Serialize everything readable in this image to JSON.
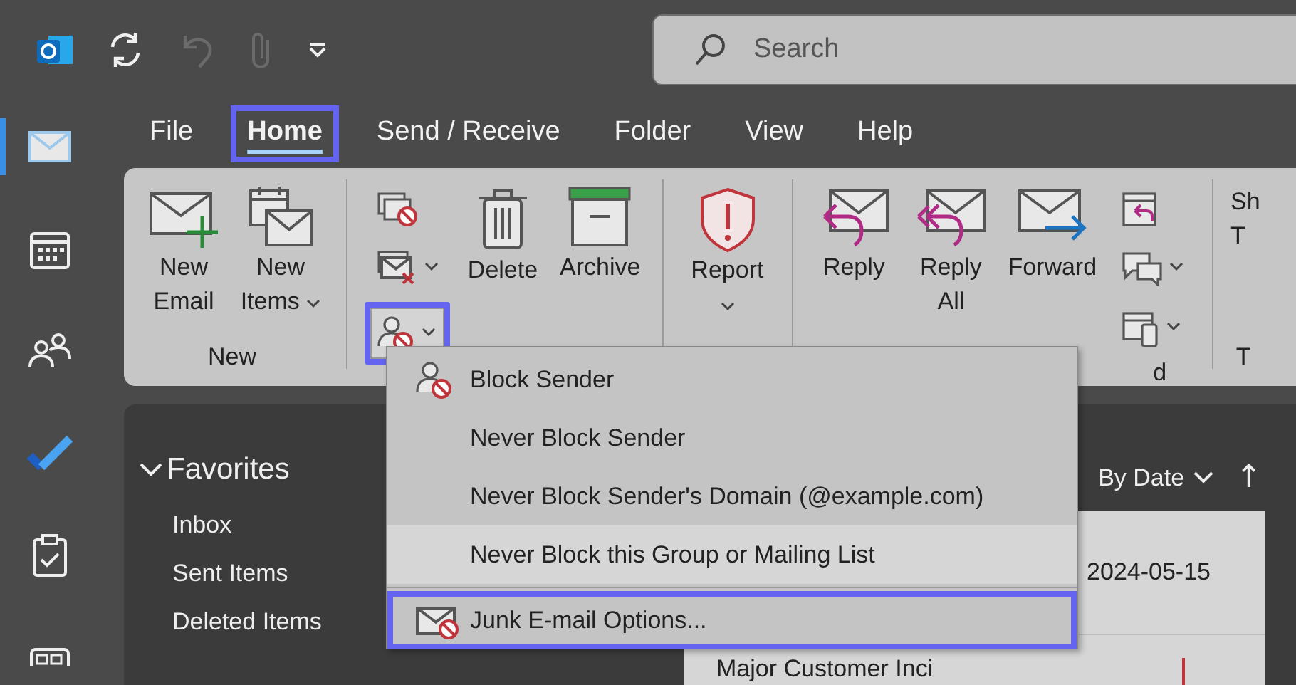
{
  "title_bar": {
    "quick_access": [
      {
        "kind": "sync",
        "disabled": false
      },
      {
        "kind": "undo",
        "disabled": true
      },
      {
        "kind": "attach",
        "disabled": true
      },
      {
        "kind": "customize",
        "disabled": false
      }
    ],
    "search": {
      "placeholder": "Search"
    }
  },
  "nav_rail": [
    {
      "kind": "mail",
      "selected": true
    },
    {
      "kind": "calendar",
      "selected": false
    },
    {
      "kind": "people",
      "selected": false
    },
    {
      "kind": "todo",
      "selected": false
    },
    {
      "kind": "tasks",
      "selected": false
    },
    {
      "kind": "apps",
      "selected": false
    }
  ],
  "menu_tabs": [
    {
      "label": "File",
      "selected": false,
      "highlighted": false
    },
    {
      "label": "Home",
      "selected": true,
      "highlighted": true
    },
    {
      "label": "Send / Receive",
      "selected": false,
      "highlighted": false
    },
    {
      "label": "Folder",
      "selected": false,
      "highlighted": false
    },
    {
      "label": "View",
      "selected": false,
      "highlighted": false
    },
    {
      "label": "Help",
      "selected": false,
      "highlighted": false
    }
  ],
  "ribbon": {
    "groups": [
      {
        "label": "New",
        "buttons": [
          {
            "kind": "new-email",
            "label": "New Email",
            "dropdown": false
          },
          {
            "kind": "new-items",
            "label": "New Items",
            "dropdown": true
          }
        ]
      },
      {
        "small_buttons": [
          {
            "kind": "ignore",
            "dropdown": false,
            "highlighted": false
          },
          {
            "kind": "clean-up",
            "dropdown": true,
            "highlighted": false
          },
          {
            "kind": "junk",
            "dropdown": true,
            "highlighted": true
          }
        ],
        "buttons": [
          {
            "kind": "delete",
            "label": "Delete",
            "dropdown": false
          },
          {
            "kind": "archive",
            "label": "Archive",
            "dropdown": false
          }
        ]
      },
      {
        "buttons": [
          {
            "kind": "report",
            "label": "Report",
            "dropdown": true
          }
        ]
      },
      {
        "label": "d",
        "buttons": [
          {
            "kind": "reply",
            "label": "Reply",
            "dropdown": false
          },
          {
            "kind": "reply-all",
            "label": "Reply All",
            "dropdown": false
          },
          {
            "kind": "forward",
            "label": "Forward",
            "dropdown": false
          }
        ],
        "small_buttons": [
          {
            "kind": "meeting-reply",
            "dropdown": false,
            "highlighted": false
          },
          {
            "kind": "chat",
            "dropdown": true,
            "highlighted": false
          },
          {
            "kind": "device",
            "dropdown": true,
            "highlighted": false
          }
        ]
      },
      {
        "label": "T",
        "buttons": [
          {
            "kind": "partial",
            "label": "Sh T",
            "dropdown": false
          }
        ]
      }
    ]
  },
  "junk_menu": {
    "items": [
      {
        "kind": "block",
        "label": "Block Sender",
        "hovered": false,
        "highlighted": false
      },
      {
        "kind": "plain",
        "label": "Never Block Sender",
        "hovered": false,
        "highlighted": false
      },
      {
        "kind": "plain",
        "label": "Never Block Sender's Domain (@example.com)",
        "hovered": false,
        "highlighted": false
      },
      {
        "kind": "plain",
        "label": "Never Block this Group or Mailing List",
        "hovered": true,
        "highlighted": false
      },
      {
        "kind": "options",
        "label": "Junk E-mail Options...",
        "hovered": false,
        "highlighted": true
      }
    ]
  },
  "folder_pane": {
    "header": "Favorites",
    "expanded": true,
    "items": [
      "Inbox",
      "Sent Items",
      "Deleted Items"
    ]
  },
  "mail_list": {
    "sort": {
      "label": "By Date",
      "direction": "↑"
    },
    "items": [
      {
        "date": "2024-05-15",
        "important": false
      },
      {
        "subject": "Major Customer Inci",
        "important": true
      }
    ]
  }
}
